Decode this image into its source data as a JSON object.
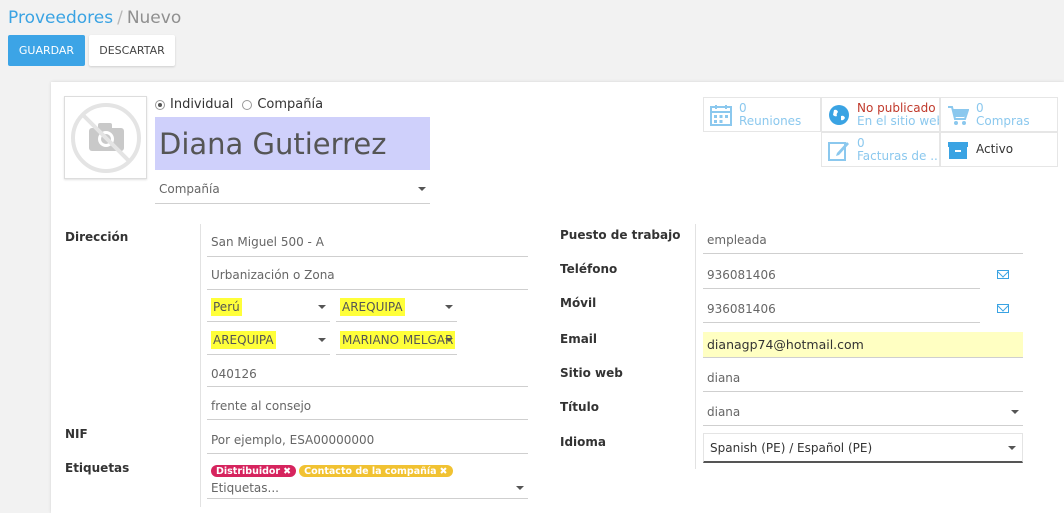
{
  "breadcrumb": {
    "parent": "Proveedores",
    "separator": "/",
    "current": "Nuevo"
  },
  "buttons": {
    "save": "GUARDAR",
    "discard": "DESCARTAR"
  },
  "company_type": {
    "individual": "Individual",
    "company": "Compañía",
    "selected": "individual"
  },
  "name": "Diana Gutierrez",
  "company_field": {
    "placeholder": "Compañía"
  },
  "address": {
    "label": "Dirección",
    "street": "San Miguel 500 - A",
    "street2_placeholder": "Urbanización o Zona",
    "country": "Perú",
    "state": "AREQUIPA",
    "province": "AREQUIPA",
    "district": "MARIANO MELGAR",
    "zip": "040126",
    "reference": "frente al consejo"
  },
  "nif": {
    "label": "NIF",
    "placeholder": "Por ejemplo, ESA00000000"
  },
  "tags": {
    "label": "Etiquetas",
    "items": [
      {
        "text": "Distribuidor",
        "color": "#d6245e"
      },
      {
        "text": "Contacto de la compañía",
        "color": "#f1c232"
      }
    ],
    "placeholder": "Etiquetas..."
  },
  "contact": {
    "job_label": "Puesto de trabajo",
    "job": "empleada",
    "phone_label": "Teléfono",
    "phone": "936081406",
    "mobile_label": "Móvil",
    "mobile": "936081406",
    "email_label": "Email",
    "email": "dianagp74@hotmail.com",
    "website_label": "Sitio web",
    "website": "diana",
    "title_label": "Título",
    "title": "diana",
    "lang_label": "Idioma",
    "lang": "Spanish (PE) / Español (PE)"
  },
  "stats": {
    "meetings_count": "0",
    "meetings_label": "Reuniones",
    "publish_line1": "No publicado",
    "publish_line2": "En el sitio web",
    "purchases_count": "0",
    "purchases_label": "Compras",
    "invoices_count": "0",
    "invoices_label": "Facturas de ...",
    "active_label": "Activo"
  },
  "colors": {
    "accent": "#3aa3e3",
    "highlight": "#ffff3a",
    "name_bg": "#cfd0fb"
  }
}
